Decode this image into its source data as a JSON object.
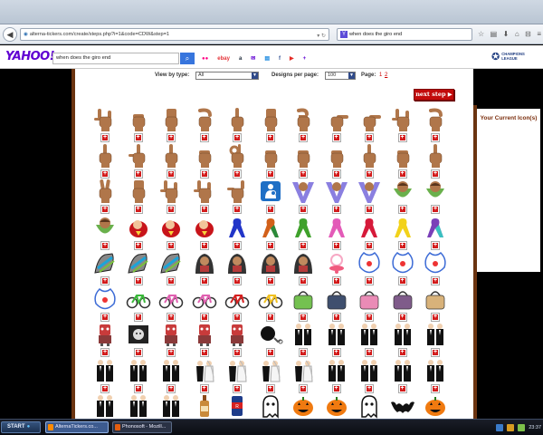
{
  "browser": {
    "url": "alterna-tickers.com/create/steps.php?i=1&code=CDW&step=1",
    "search_value": "when does the giro end",
    "search_badge": "Y"
  },
  "yahoo": {
    "logo": "YAHOO!",
    "search_value": "when does the giro end",
    "search_button_icon": "search-icon",
    "shortcuts": [
      {
        "name": "flickr",
        "label": "●●",
        "color": "#ff0084"
      },
      {
        "name": "ebay",
        "label": "ebay",
        "color": "#e53238"
      },
      {
        "name": "amazon",
        "label": "a",
        "color": "#232f3e"
      },
      {
        "name": "mail",
        "label": "✉",
        "color": "#6001d2"
      },
      {
        "name": "news",
        "label": "▤",
        "color": "#1d8be0"
      },
      {
        "name": "facebook",
        "label": "f",
        "color": "#3b5998"
      },
      {
        "name": "youtube",
        "label": "▶",
        "color": "#e52d27"
      },
      {
        "name": "more",
        "label": "+",
        "color": "#6001d2"
      }
    ],
    "partner_text": "CHAMPIONS LEAGUE"
  },
  "controls": {
    "view_label": "View by type:",
    "view_value": "All",
    "per_page_label": "Designs per page:",
    "per_page_value": "100",
    "page_label": "Page:",
    "page_current": "1",
    "page_next": "2"
  },
  "next_step": "next step ▶",
  "right_panel_title": "Your Current Icon(s)",
  "colors": {
    "skin": "#b0764a",
    "brown_strip": "#6b3410",
    "add_red": "#d21a1a",
    "next_red": "#c20a0a",
    "purple_v": "#8a7fe0",
    "green_leaf": "#6ab04c"
  },
  "icon_grid": [
    [
      "hand-ily",
      "hand-fist",
      "hand-flat",
      "hand-c",
      "hand-point-up",
      "hand-flat",
      "hand-curl",
      "hand-point-side",
      "hand-point-side",
      "hand-ily",
      "hand-c"
    ],
    [
      "hand-point-up",
      "hand-l",
      "hand-point-up",
      "hand-fist",
      "hand-ok",
      "hand-fist",
      "hand-fist",
      "hand-fist",
      "hand-point-up",
      "hand-fist",
      "hand-point-up"
    ],
    [
      "hand-peace",
      "hand-flat",
      "hand-ily",
      "hand-ily",
      "hand-y",
      "nursing-sign",
      "v-baby-purple",
      "v-baby-purple",
      "v-baby-purple",
      "baby-green-leaf",
      "baby-green-leaf"
    ],
    [
      "baby-green-leaf",
      "baby-red-pod",
      "baby-red-pod",
      "baby-red-pod",
      "ribbon-blue",
      "ribbon-multi",
      "ribbon-green",
      "ribbon-pink",
      "ribbon-red",
      "ribbon-yellow",
      "ribbon-purple"
    ],
    [
      "car-seat",
      "car-seat",
      "car-seat",
      "car-seat-baby",
      "car-seat-baby",
      "car-seat-baby",
      "car-seat-baby",
      "pacifier",
      "bib",
      "bib",
      "bib"
    ],
    [
      "bib",
      "bicycle-green",
      "bicycle-pink",
      "bicycle-pink",
      "bicycle-red",
      "bicycle-yellow",
      "bag-green",
      "bag-navy",
      "bag-pink",
      "bag-purple",
      "bag-patterned"
    ],
    [
      "monster-doll",
      "framed-face",
      "monster-doll",
      "monster-doll",
      "monster-doll",
      "ball-and-chain",
      "couple-black",
      "couple-black",
      "couple-black",
      "couple-black",
      "couple-black"
    ],
    [
      "couple-black",
      "couple-black",
      "couple-black",
      "couple-veil",
      "couple-veil",
      "couple-veil",
      "couple-veil",
      "couple-black",
      "couple-black",
      "couple-black",
      "couple-black"
    ],
    [
      "couple-black",
      "couple-black",
      "couple-black",
      "bottle",
      "soda-can",
      "ghost",
      "pumpkin",
      "pumpkin",
      "ghost",
      "bat",
      "pumpkin"
    ]
  ]
}
